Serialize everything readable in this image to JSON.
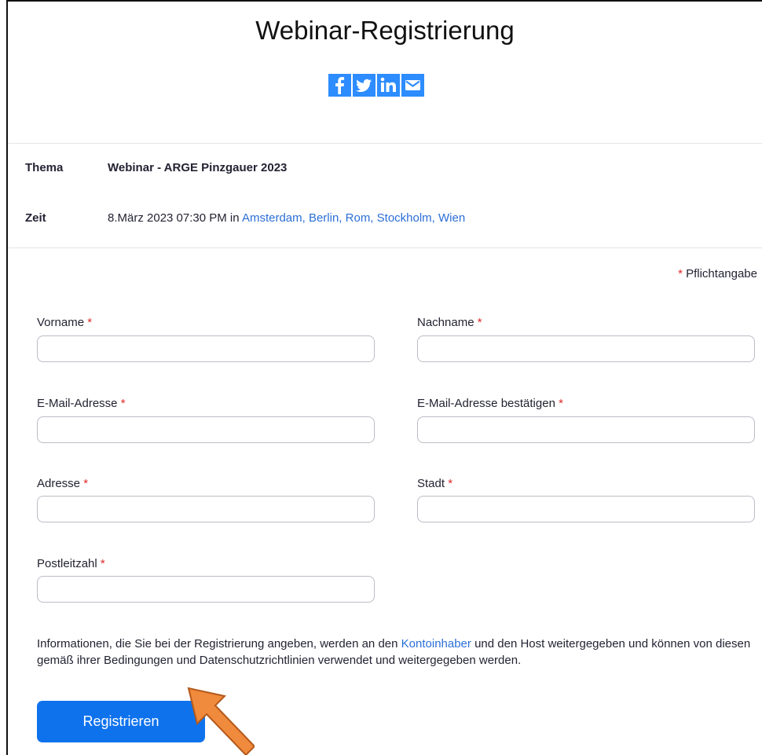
{
  "page": {
    "title": "Webinar-Registrierung"
  },
  "social": [
    {
      "icon": "facebook-icon",
      "glyph": "f"
    },
    {
      "icon": "twitter-icon",
      "glyph": "t"
    },
    {
      "icon": "linkedin-icon",
      "glyph": "in"
    },
    {
      "icon": "email-icon",
      "glyph": "✉"
    }
  ],
  "info": {
    "topic_label": "Thema",
    "topic_value": "Webinar - ARGE Pinzgauer 2023",
    "time_label": "Zeit",
    "time_value": "8.März 2023 07:30 PM in",
    "timezone_link": "Amsterdam, Berlin, Rom, Stockholm, Wien"
  },
  "required_note": {
    "star": "*",
    "text": "Pflichtangabe"
  },
  "form": {
    "firstname": {
      "label": "Vorname",
      "value": "",
      "placeholder": ""
    },
    "lastname": {
      "label": "Nachname",
      "value": "",
      "placeholder": ""
    },
    "email": {
      "label": "E-Mail-Adresse",
      "value": "",
      "placeholder": ""
    },
    "email_confirm": {
      "label": "E-Mail-Adresse bestätigen",
      "value": "",
      "placeholder": ""
    },
    "address": {
      "label": "Adresse",
      "value": "",
      "placeholder": ""
    },
    "city": {
      "label": "Stadt",
      "value": "",
      "placeholder": ""
    },
    "zip": {
      "label": "Postleitzahl",
      "value": "",
      "placeholder": ""
    },
    "required_star": "*"
  },
  "disclaimer": {
    "part1": "Informationen, die Sie bei der Registrierung angeben, werden an den",
    "link": "Kontoinhaber",
    "part2": "und den Host weitergegeben und können von diesen gemäß ihrer Bedingungen und Datenschutzrichtlinien verwendet und weitergegeben werden."
  },
  "submit": {
    "label": "Registrieren"
  },
  "colors": {
    "accent": "#0e72ed",
    "link": "#2b6fd6",
    "required": "#e02828",
    "social": "#2d8cff",
    "annotation_arrow": "#f08a3c"
  }
}
